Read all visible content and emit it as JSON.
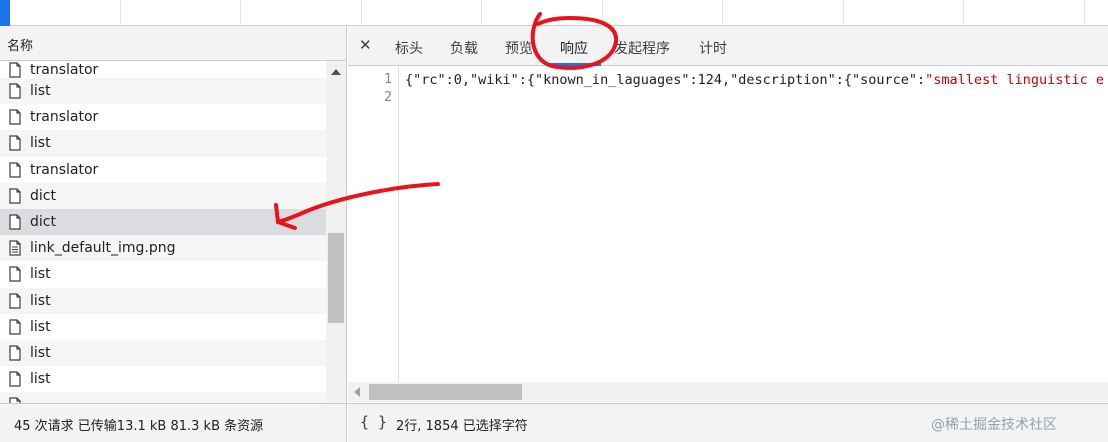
{
  "left_panel": {
    "column_header": "名称",
    "files": [
      {
        "name": "translator",
        "icon": "file-icon"
      },
      {
        "name": "list",
        "icon": "file-icon"
      },
      {
        "name": "translator",
        "icon": "file-icon"
      },
      {
        "name": "list",
        "icon": "file-icon"
      },
      {
        "name": "translator",
        "icon": "file-icon"
      },
      {
        "name": "dict",
        "icon": "file-icon"
      },
      {
        "name": "dict",
        "icon": "file-icon",
        "selected": true
      },
      {
        "name": "link_default_img.png",
        "icon": "image-file-icon"
      },
      {
        "name": "list",
        "icon": "file-icon"
      },
      {
        "name": "list",
        "icon": "file-icon"
      },
      {
        "name": "list",
        "icon": "file-icon"
      },
      {
        "name": "list",
        "icon": "file-icon"
      },
      {
        "name": "list",
        "icon": "file-icon"
      },
      {
        "name": "",
        "icon": "file-icon"
      }
    ],
    "status": "45 次请求  已传输13.1 kB  81.3 kB 条资源"
  },
  "right_panel": {
    "close_symbol": "✕",
    "tabs": [
      {
        "label": "标头"
      },
      {
        "label": "负载"
      },
      {
        "label": "预览"
      },
      {
        "label": "响应",
        "active": true
      },
      {
        "label": "发起程序"
      },
      {
        "label": "计时"
      }
    ],
    "code_lines": [
      {
        "number": "1",
        "text_plain": "{\"rc\":0,\"wiki\":{\"known_in_laguages\":124,\"description\":{\"source\":",
        "text_string": "\"smallest linguistic e"
      },
      {
        "number": "2",
        "text_plain": "",
        "text_string": ""
      }
    ],
    "status": {
      "braces": "{ }",
      "selection": "2行, 1854 已选择字符",
      "watermark": "@稀土掘金技术社区"
    }
  },
  "colors": {
    "accent": "#1a73e8",
    "annotation": "#e8141b",
    "string": "#c80000"
  }
}
